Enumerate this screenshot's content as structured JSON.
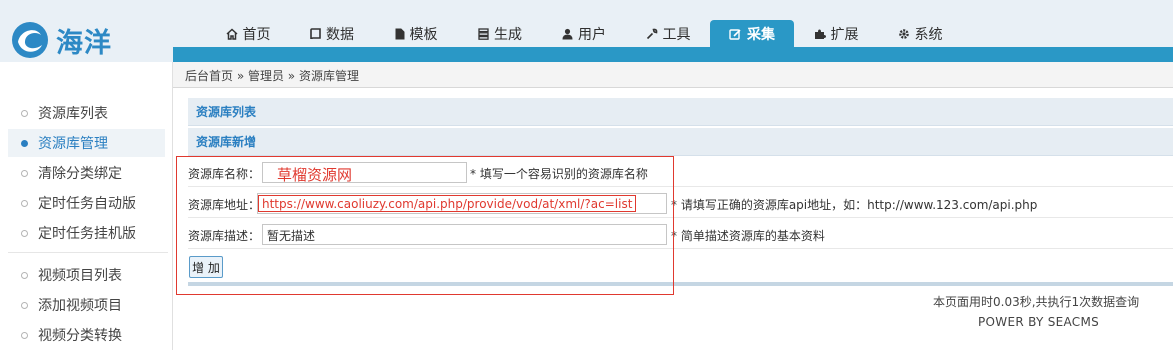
{
  "logo": {
    "text": "海洋"
  },
  "nav": {
    "items": [
      {
        "label": "首页",
        "icon": "home-icon",
        "active": false
      },
      {
        "label": "数据",
        "icon": "book-icon",
        "active": false
      },
      {
        "label": "模板",
        "icon": "file-icon",
        "active": false
      },
      {
        "label": "生成",
        "icon": "server-icon",
        "active": false
      },
      {
        "label": "用户",
        "icon": "user-icon",
        "active": false
      },
      {
        "label": "工具",
        "icon": "wrench-icon",
        "active": false
      },
      {
        "label": "采集",
        "icon": "edit-icon",
        "active": true
      },
      {
        "label": "扩展",
        "icon": "puzzle-icon",
        "active": false
      },
      {
        "label": "系统",
        "icon": "gear-icon",
        "active": false
      }
    ]
  },
  "breadcrumb": {
    "text": "后台首页 » 管理员 » 资源库管理"
  },
  "sidebar": {
    "items": [
      {
        "label": "资源库列表",
        "active": false
      },
      {
        "label": "资源库管理",
        "active": true
      },
      {
        "label": "清除分类绑定",
        "active": false
      },
      {
        "label": "定时任务自动版",
        "active": false
      },
      {
        "label": "定时任务挂机版",
        "active": false
      },
      {
        "label": "视频项目列表",
        "active": false
      },
      {
        "label": "添加视频项目",
        "active": false
      },
      {
        "label": "视频分类转换",
        "active": false
      }
    ]
  },
  "main": {
    "section_list_label": "资源库列表",
    "section_add_label": "资源库新增",
    "form": {
      "name_label": "资源库名称：",
      "name_value": "",
      "name_hint": "* 填写一个容易识别的资源库名称",
      "url_label": "资源库地址：",
      "url_value": "",
      "url_hint": "* 请填写正确的资源库api地址，如：http://www.123.com/api.php",
      "desc_label": "资源库描述：",
      "desc_value": "暂无描述",
      "desc_hint": "* 简单描述资源库的基本资料",
      "submit_label": "增 加"
    },
    "annotations": {
      "name_text": "草榴资源网",
      "url_text": "https://www.caoliuzy.com/api.php/provide/vod/at/xml/?ac=list"
    }
  },
  "footer": {
    "time_text": "本页面用时0.03秒,共执行1次数据查询",
    "power_text": "POWER BY SEACMS"
  },
  "colors": {
    "accent": "#2a98c6",
    "link": "#2a7fc1",
    "annotation": "#e0392f"
  }
}
